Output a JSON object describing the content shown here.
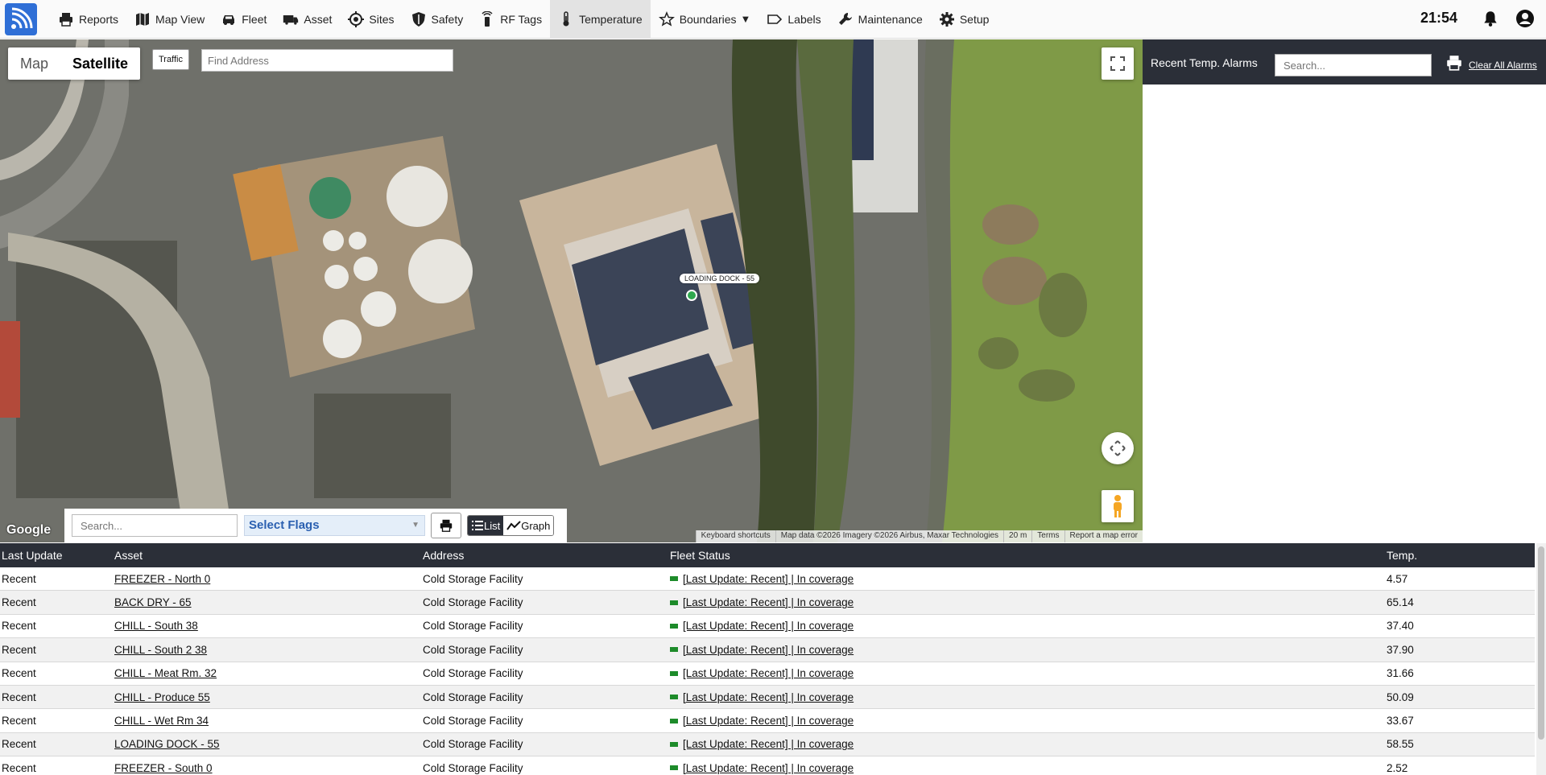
{
  "nav": {
    "items": [
      {
        "label": "Reports",
        "icon": "printer-icon"
      },
      {
        "label": "Map View",
        "icon": "map-icon"
      },
      {
        "label": "Fleet",
        "icon": "car-icon"
      },
      {
        "label": "Asset",
        "icon": "truck-icon"
      },
      {
        "label": "Sites",
        "icon": "target-icon"
      },
      {
        "label": "Safety",
        "icon": "shield-icon"
      },
      {
        "label": "RF Tags",
        "icon": "rf-tag-icon"
      },
      {
        "label": "Temperature",
        "icon": "thermometer-icon",
        "active": true
      },
      {
        "label": "Boundaries",
        "icon": "star-icon",
        "dropdown": true
      },
      {
        "label": "Labels",
        "icon": "label-icon"
      },
      {
        "label": "Maintenance",
        "icon": "wrench-icon"
      },
      {
        "label": "Setup",
        "icon": "gear-icon"
      }
    ],
    "clock": "21:54"
  },
  "map": {
    "type_map": "Map",
    "type_satellite": "Satellite",
    "traffic": "Traffic",
    "find_address_placeholder": "Find Address",
    "marker_label": "LOADING DOCK - 55",
    "google": "Google",
    "attribution": {
      "shortcuts": "Keyboard shortcuts",
      "data": "Map data ©2026 Imagery ©2026 Airbus, Maxar Technologies",
      "scale": "20 m",
      "terms": "Terms",
      "report": "Report a map error"
    }
  },
  "toolbar": {
    "search_placeholder": "Search...",
    "flags": "Select Flags",
    "list": "List",
    "graph": "Graph"
  },
  "panel": {
    "title": "Recent Temp. Alarms",
    "search_placeholder": "Search...",
    "clear": "Clear All Alarms"
  },
  "table": {
    "headers": {
      "last_update": "Last Update",
      "asset": "Asset",
      "address": "Address",
      "fleet_status": "Fleet Status",
      "temp": "Temp."
    },
    "rows": [
      {
        "last_update": "Recent",
        "asset": "FREEZER - North 0",
        "address": "Cold Storage Facility",
        "status": "[Last Update: Recent] | In coverage",
        "temp": "4.57"
      },
      {
        "last_update": "Recent",
        "asset": "BACK DRY - 65",
        "address": "Cold Storage Facility",
        "status": "[Last Update: Recent] | In coverage",
        "temp": "65.14"
      },
      {
        "last_update": "Recent",
        "asset": "CHILL - South 38",
        "address": "Cold Storage Facility",
        "status": "[Last Update: Recent] | In coverage",
        "temp": "37.40"
      },
      {
        "last_update": "Recent",
        "asset": "CHILL - South 2 38",
        "address": "Cold Storage Facility",
        "status": "[Last Update: Recent] | In coverage",
        "temp": "37.90"
      },
      {
        "last_update": "Recent",
        "asset": "CHILL - Meat Rm. 32",
        "address": "Cold Storage Facility",
        "status": "[Last Update: Recent] | In coverage",
        "temp": "31.66"
      },
      {
        "last_update": "Recent",
        "asset": "CHILL - Produce 55",
        "address": "Cold Storage Facility",
        "status": "[Last Update: Recent] | In coverage",
        "temp": "50.09"
      },
      {
        "last_update": "Recent",
        "asset": "CHILL - Wet Rm 34",
        "address": "Cold Storage Facility",
        "status": "[Last Update: Recent] | In coverage",
        "temp": "33.67"
      },
      {
        "last_update": "Recent",
        "asset": "LOADING DOCK - 55",
        "address": "Cold Storage Facility",
        "status": "[Last Update: Recent] | In coverage",
        "temp": "58.55"
      },
      {
        "last_update": "Recent",
        "asset": "FREEZER - South 0",
        "address": "Cold Storage Facility",
        "status": "[Last Update: Recent] | In coverage",
        "temp": "2.52"
      }
    ]
  }
}
